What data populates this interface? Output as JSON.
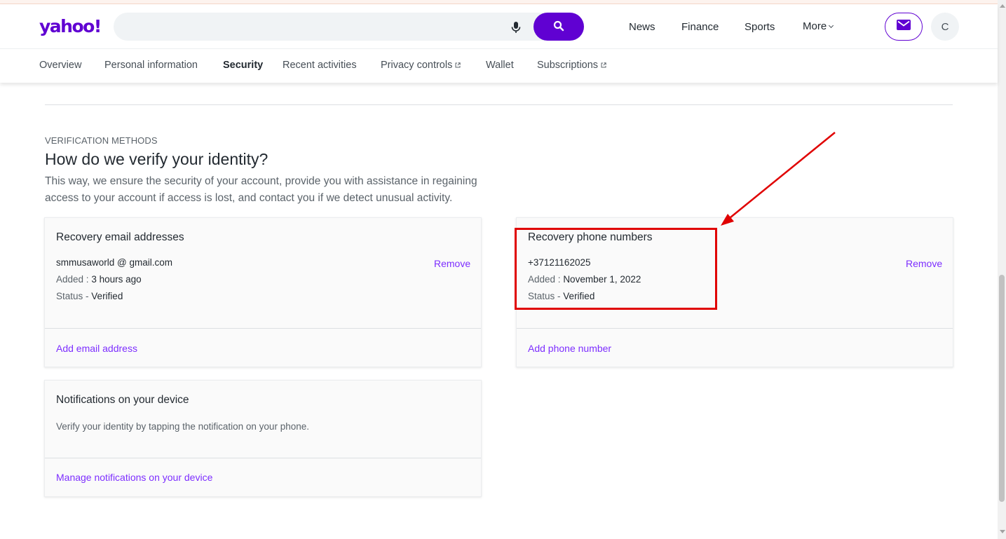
{
  "brand": {
    "logo_text": "yahoo!",
    "accent": "#6001d2",
    "link_color": "#7d2eff"
  },
  "search": {
    "value": "",
    "placeholder": "",
    "mic_icon": "mic-icon",
    "button_icon": "search-icon"
  },
  "top_nav": [
    "News",
    "Finance",
    "Sports",
    "More"
  ],
  "account": {
    "mail_icon": "mail-icon",
    "avatar_initial": "C"
  },
  "sub_nav": {
    "items": [
      "Overview",
      "Personal information",
      "Security",
      "Recent activities",
      "Privacy controls",
      "Wallet",
      "Subscriptions"
    ],
    "active": "Security"
  },
  "section": {
    "eyebrow": "VERIFICATION METHODS",
    "title": "How do we verify your identity?",
    "description": "This way, we ensure the security of your account, provide you with assistance in regaining access to your account if access is lost, and contact you if we detect unusual activity."
  },
  "email_card": {
    "title": "Recovery email addresses",
    "address": "smmusaworld @ gmail.com",
    "added_label": "Added :",
    "added_value": "3 hours ago",
    "status_label": "Status -",
    "status_value": "Verified",
    "remove_label": "Remove",
    "add_link": "Add email address"
  },
  "phone_card": {
    "title": "Recovery phone numbers",
    "number": "+37121162025",
    "added_label": "Added :",
    "added_value": "November 1, 2022",
    "status_label": "Status -",
    "status_value": "Verified",
    "remove_label": "Remove",
    "add_link": "Add phone number"
  },
  "device_card": {
    "title": "Notifications on your device",
    "description": "Verify your identity by tapping the notification on your phone.",
    "manage_link": "Manage notifications on your device"
  },
  "annotation": {
    "color": "#e00000"
  }
}
